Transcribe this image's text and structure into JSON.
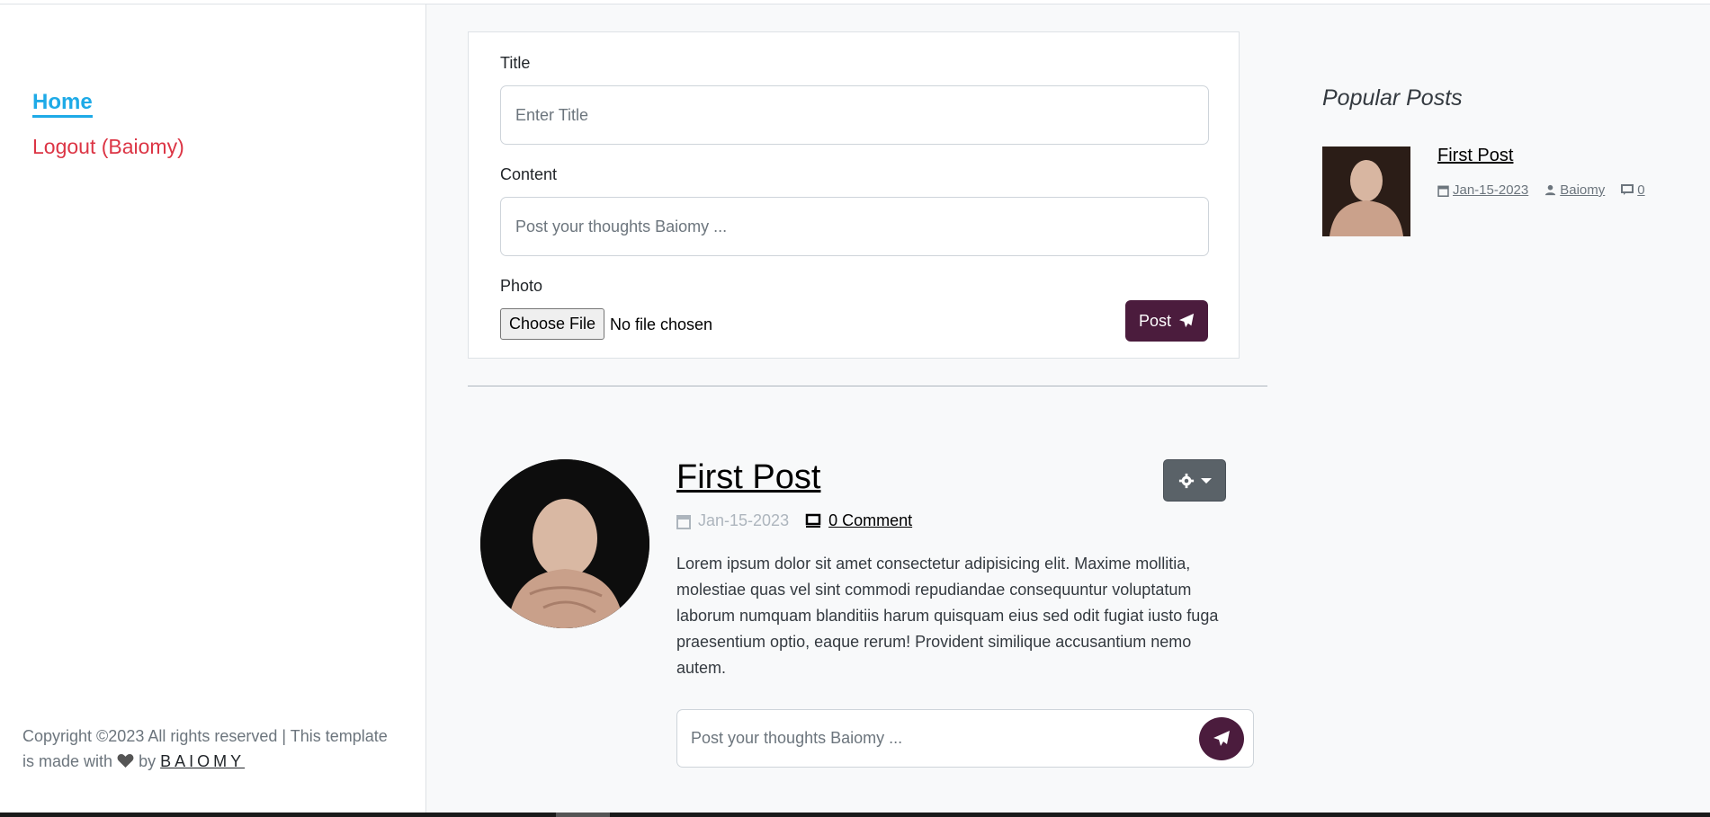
{
  "nav": {
    "home": "Home",
    "logout": "Logout (Baiomy)"
  },
  "footer": {
    "copyright": "Copyright ©2023 All rights reserved | This template is made with",
    "by": "by",
    "brand": "BAIOMY"
  },
  "form": {
    "title_label": "Title",
    "title_placeholder": "Enter Title",
    "content_label": "Content",
    "content_placeholder": "Post your thoughts Baiomy ...",
    "photo_label": "Photo",
    "choose_file": "Choose File",
    "no_file": "No file chosen",
    "post_button": "Post"
  },
  "post": {
    "title": "First Post",
    "date": "Jan-15-2023",
    "comments": "0 Comment",
    "body": "Lorem ipsum dolor sit amet consectetur adipisicing elit. Maxime mollitia, molestiae quas vel sint commodi repudiandae consequuntur voluptatum laborum numquam blanditiis harum quisquam eius sed odit fugiat iusto fuga praesentium optio, eaque rerum! Provident similique accusantium nemo autem.",
    "comment_placeholder": "Post your thoughts Baiomy ..."
  },
  "popular": {
    "heading": "Popular Posts",
    "items": [
      {
        "title": "First Post",
        "date": "Jan-15-2023",
        "author": "Baiomy",
        "comments": "0"
      }
    ]
  },
  "colors": {
    "primary": "#1eaae7",
    "danger": "#dc3545",
    "accent": "#4b1c3d",
    "muted": "#6c757d"
  }
}
